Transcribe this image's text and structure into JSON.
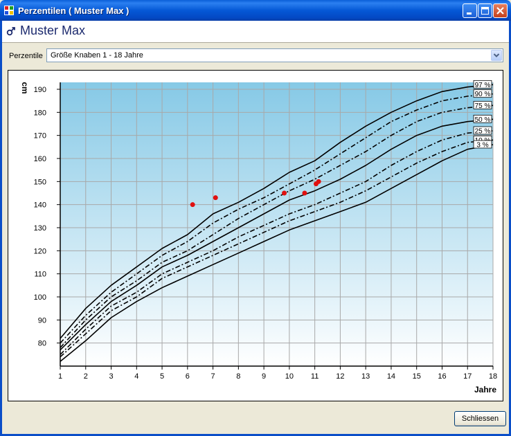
{
  "window": {
    "title": "Perzentilen ( Muster Max )",
    "app_icon": "app-icon",
    "buttons": [
      "minimize-icon",
      "maximize-icon",
      "close-icon"
    ]
  },
  "header": {
    "gender_icon": "male-symbol-icon",
    "patient_name": "Muster Max"
  },
  "selector": {
    "label": "Perzentile",
    "value": "Größe Knaben 1 - 18 Jahre"
  },
  "footer": {
    "close_label": "Schliessen"
  },
  "colors": {
    "accent": "#0a4ec8",
    "plot_top": "#86c9e6",
    "plot_bottom": "#ffffff",
    "measurement_dot": "#e01010"
  },
  "chart_data": {
    "type": "line",
    "ylabel": "cm",
    "xlabel": "Jahre",
    "xlim": [
      1,
      18
    ],
    "ylim": [
      70,
      193
    ],
    "x_ticks": [
      1,
      2,
      3,
      4,
      5,
      6,
      7,
      8,
      9,
      10,
      11,
      12,
      13,
      14,
      15,
      16,
      17,
      18
    ],
    "y_ticks": [
      80,
      90,
      100,
      110,
      120,
      130,
      140,
      150,
      160,
      170,
      180,
      190
    ],
    "grid": true,
    "legend_position": "right-end",
    "x": [
      1,
      2,
      3,
      4,
      5,
      6,
      7,
      8,
      9,
      10,
      11,
      12,
      13,
      14,
      15,
      16,
      17,
      18
    ],
    "series": [
      {
        "name": "97 %",
        "style": "solid",
        "values": [
          82,
          95,
          105,
          113,
          121,
          127,
          136,
          141,
          147,
          154,
          159,
          167,
          174,
          180,
          185,
          189,
          191,
          192
        ]
      },
      {
        "name": "90 %",
        "style": "dashdot",
        "values": [
          80,
          92,
          102,
          110,
          118,
          124,
          132,
          138,
          143,
          149,
          155,
          162,
          169,
          176,
          181,
          185,
          187,
          188
        ]
      },
      {
        "name": "75 %",
        "style": "dashdot",
        "values": [
          78,
          90,
          100,
          107,
          115,
          120,
          127,
          134,
          140,
          146,
          151,
          157,
          163,
          170,
          176,
          180,
          182,
          183
        ]
      },
      {
        "name": "50 %",
        "style": "solid",
        "values": [
          77,
          88,
          98,
          105,
          113,
          118,
          124,
          130,
          136,
          142,
          146,
          151,
          157,
          164,
          170,
          174,
          176,
          177
        ]
      },
      {
        "name": "25 %",
        "style": "dashdot",
        "values": [
          75,
          86,
          96,
          102,
          110,
          115,
          120,
          126,
          131,
          136,
          140,
          145,
          150,
          157,
          163,
          168,
          171,
          172
        ]
      },
      {
        "name": "10 %",
        "style": "dashdot",
        "values": [
          74,
          84,
          94,
          100,
          108,
          113,
          118,
          123,
          128,
          133,
          137,
          141,
          146,
          152,
          158,
          163,
          167,
          168
        ]
      },
      {
        "name": "3 %",
        "style": "solid",
        "values": [
          72,
          81,
          91,
          98,
          104,
          109,
          114,
          119,
          124,
          129,
          133,
          137,
          141,
          147,
          153,
          159,
          164,
          166
        ]
      }
    ],
    "measurements": [
      {
        "x": 6.2,
        "y": 140
      },
      {
        "x": 7.1,
        "y": 143
      },
      {
        "x": 9.8,
        "y": 145
      },
      {
        "x": 10.6,
        "y": 145
      },
      {
        "x": 11.05,
        "y": 149
      },
      {
        "x": 11.15,
        "y": 150
      }
    ]
  }
}
